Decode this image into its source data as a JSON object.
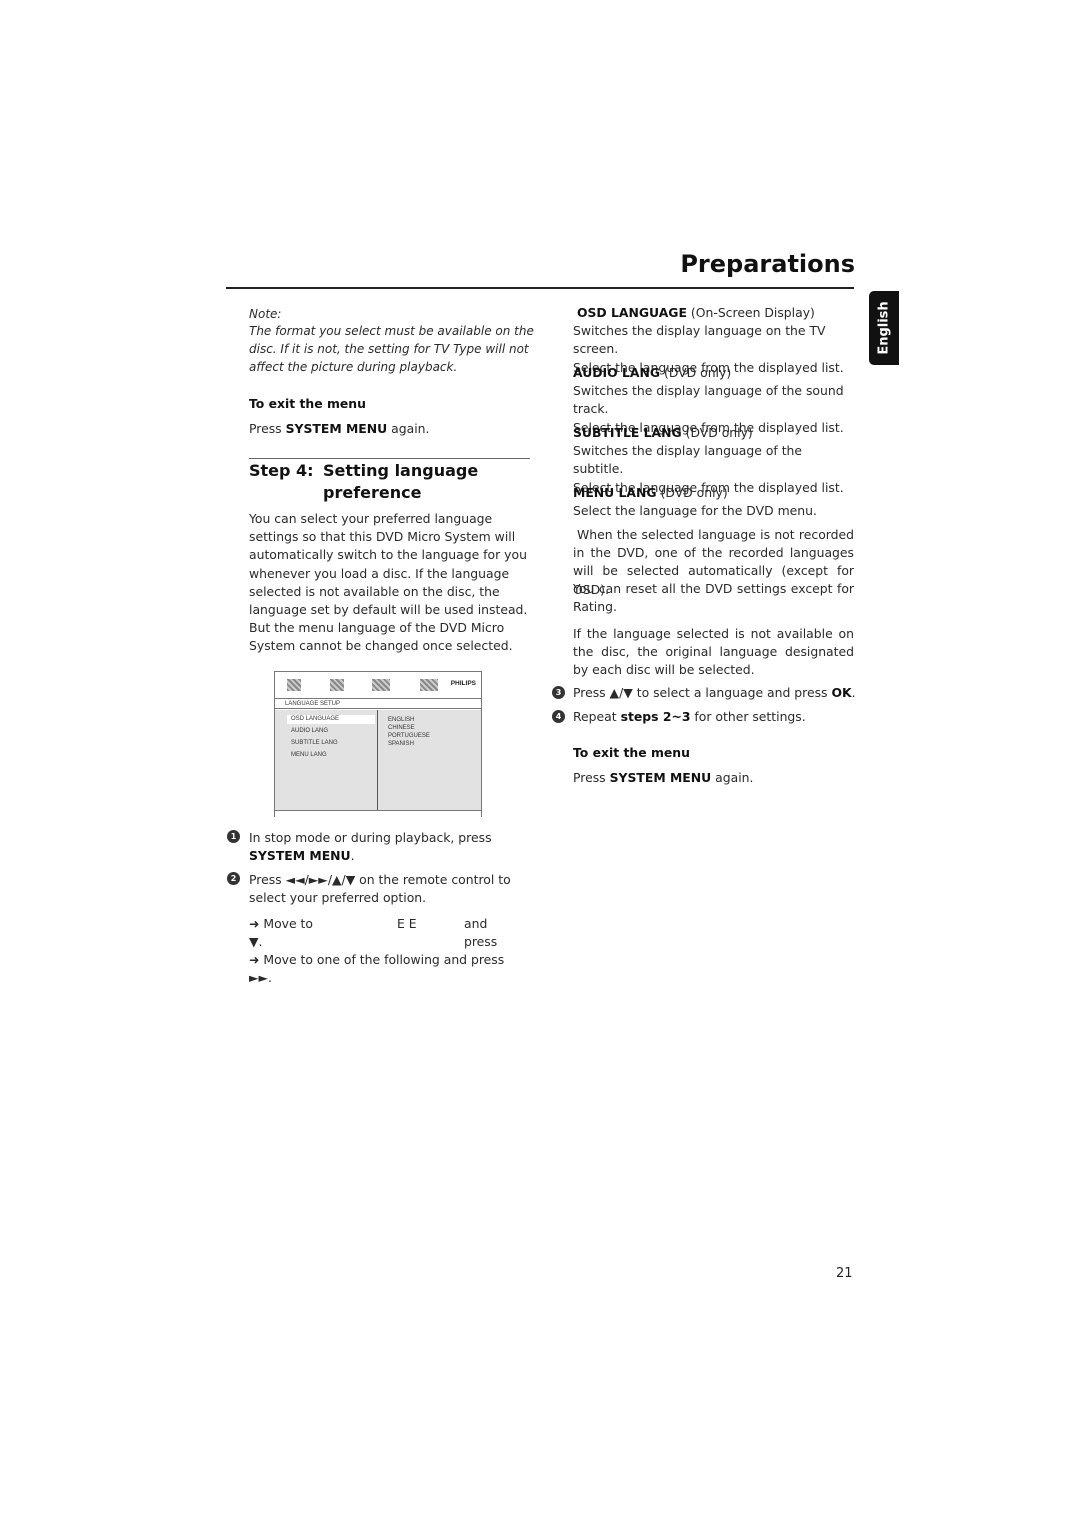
{
  "header": {
    "title": "Preparations",
    "language_tab": "English"
  },
  "left_column": {
    "note_label": "Note:",
    "note_text": "The format you select must be available on the disc. If it is not, the setting for TV Type will not affect the picture during playback.",
    "exit_heading": "To exit the menu",
    "exit_press": "Press",
    "exit_key": "SYSTEM MENU",
    "exit_again": "again.",
    "step_number": "Step 4:",
    "step_title_line1": "Setting language",
    "step_title_line2": "preference",
    "intro": "You can select your preferred language settings so that this DVD Micro System will automatically switch to the language for you whenever you load a disc. If the language selected is not available on the disc, the language set by default will be used instead. But the menu language of the DVD Micro System cannot be changed once selected.",
    "menu_screen": {
      "brand": "PHILIPS",
      "heading": "LANGUAGE SETUP",
      "items": [
        "OSD LANGUAGE",
        "AUDIO LANG",
        "SUBTITLE LANG",
        "MENU LANG"
      ],
      "selected_item": "OSD LANGUAGE",
      "options": [
        "ENGLISH",
        "CHINESE",
        "PORTUGUESE",
        "SPANISH"
      ],
      "icons": [
        "general-setup-icon",
        "video-setup-icon",
        "audio-setup-icon",
        "preference-icon"
      ]
    },
    "steps": [
      {
        "num": "1",
        "text": "In stop mode or during playback, press",
        "key": "SYSTEM MENU",
        "tail": "."
      },
      {
        "num": "2",
        "text": "Press ◄◄/►►/▲/▼ on the remote control to select your preferred option."
      }
    ],
    "sub1_prefix": "Move to",
    "sub1_middle": "E  E",
    "sub1_suffix": "and press",
    "sub1_end": "▼.",
    "sub2": "Move to one of the following and press ►►."
  },
  "right_column": {
    "items": [
      {
        "name": "OSD LANGUAGE",
        "qualifier": "(On-Screen Display)",
        "lines": [
          "Switches the display language on the TV screen.",
          "Select the language from the displayed list."
        ]
      },
      {
        "name": "AUDIO LANG",
        "qualifier": "(DVD only)",
        "lines": [
          "Switches the display language of the sound track.",
          "Select the language from the displayed list."
        ]
      },
      {
        "name": "SUBTITLE LANG",
        "qualifier": "(DVD only)",
        "lines": [
          "Switches the display language of the subtitle.",
          "Select the language from the displayed list."
        ]
      },
      {
        "name": "MENU LANG",
        "qualifier": "(DVD only)",
        "lines": [
          "Select the language for the DVD menu."
        ]
      }
    ],
    "para1": "When the selected language is not recorded in the DVD, one of the recorded languages will be selected automatically (except for OSD).",
    "para2": "You can reset all the DVD settings except for Rating.",
    "para3": "If the language selected is not available on the disc, the original language designated by each disc will be selected.",
    "step3_num": "3",
    "step3_text": "Press ▲/▼ to select a language and press",
    "step3_key": "OK",
    "step3_tail": ".",
    "step4_num": "4",
    "step4_prefix": "Repeat",
    "step4_bold": "steps 2~3",
    "step4_suffix": "for other settings.",
    "exit_heading": "To exit the menu",
    "exit_press": "Press",
    "exit_key": "SYSTEM MENU",
    "exit_again": "again."
  },
  "footer": {
    "page_number": "21"
  }
}
